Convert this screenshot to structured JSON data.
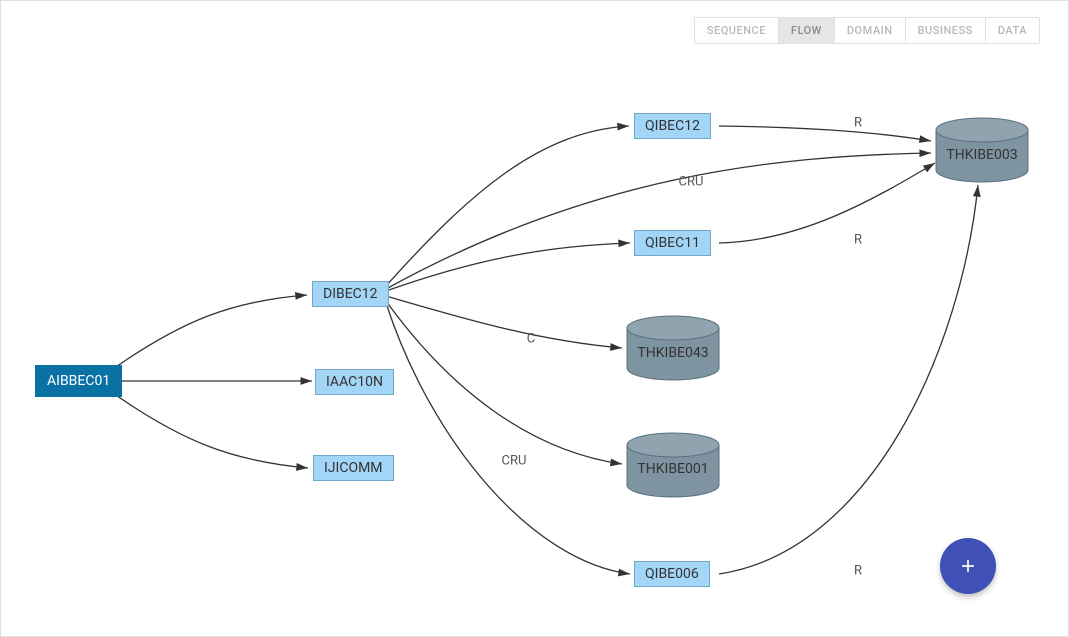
{
  "tabs": {
    "items": [
      {
        "label": "SEQUENCE",
        "active": false
      },
      {
        "label": "FLOW",
        "active": true
      },
      {
        "label": "DOMAIN",
        "active": false
      },
      {
        "label": "BUSINESS",
        "active": false
      },
      {
        "label": "DATA",
        "active": false
      }
    ]
  },
  "nodes": {
    "root": "AIBBEC01",
    "dibec12": "DIBEC12",
    "iaac10n": "IAAC10N",
    "ijicomm": "IJICOMM",
    "qibec12": "QIBEC12",
    "qibec11": "QIBEC11",
    "qibe006": "QIBE006",
    "thkibe043": "THKIBE043",
    "thkibe001": "THKIBE001",
    "thkibe003": "THKIBE003"
  },
  "edge_labels": {
    "e_qibec12_thk003": "R",
    "e_dibec12_thk003": "CRU",
    "e_qibec11_thk003": "R",
    "e_dibec12_thk043": "C",
    "e_dibec12_thk001": "CRU",
    "e_qibe006_thk003": "R"
  },
  "colors": {
    "root_bg": "#0A71A5",
    "node_bg": "#A3D5F7",
    "node_border": "#6FA8C8",
    "cylinder_fill": "#7E94A1",
    "cylinder_stroke": "#5A707D",
    "edge": "#333333",
    "fab": "#3F51B5"
  }
}
